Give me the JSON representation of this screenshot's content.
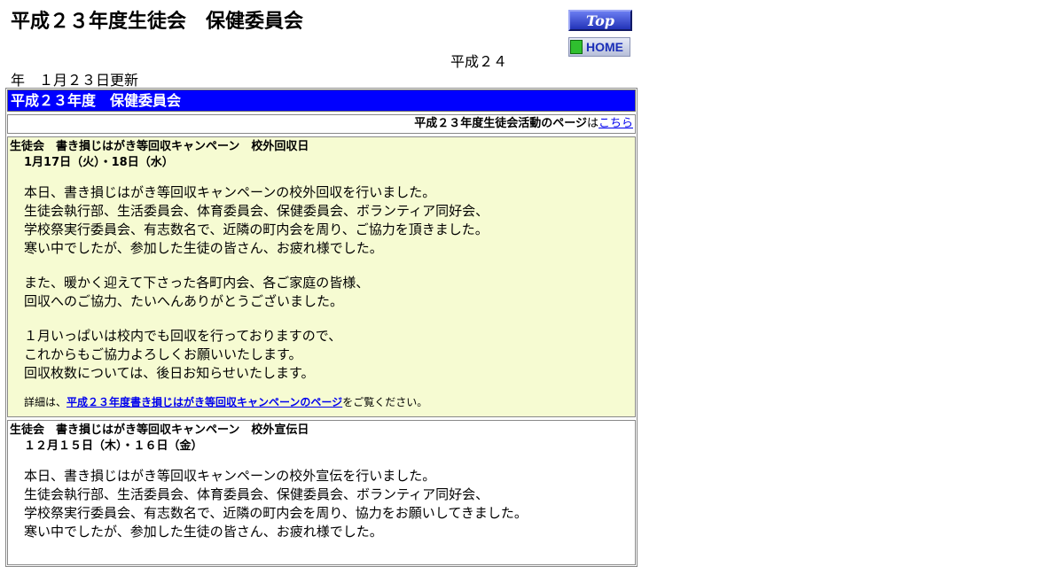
{
  "header": {
    "title": "平成２３年度生徒会　保健委員会",
    "update_part1": "平成２４",
    "update_part2": "年　１月２３日更新",
    "top_button_label": "Top",
    "home_button_label": "HOME"
  },
  "section": {
    "heading": "平成２３年度　保健委員会",
    "link_prefix": "平成２３年度生徒会活動のページ",
    "link_middle": "は",
    "link_text": "こちら"
  },
  "articles": [
    {
      "title": "生徒会　書き損じはがき等回収キャンペーン　校外回収日",
      "date": "1月17日（火）・18日（水）",
      "paragraphs": [
        [
          "本日、書き損じはがき等回収キャンペーンの校外回収を行いました。",
          "生徒会執行部、生活委員会、体育委員会、保健委員会、ボランティア同好会、",
          "学校祭実行委員会、有志数名で、近隣の町内会を周り、ご協力を頂きました。",
          "寒い中でしたが、参加した生徒の皆さん、お疲れ様でした。"
        ],
        [
          "また、暖かく迎えて下さった各町内会、各ご家庭の皆様、",
          "回収へのご協力、たいへんありがとうございました。"
        ],
        [
          "１月いっぱいは校内でも回収を行っておりますので、",
          "これからもご協力よろしくお願いいたします。",
          "回収枚数については、後日お知らせいたします。"
        ]
      ],
      "detail_prefix": "詳細は、",
      "detail_link": "平成２３年度書き損じはがき等回収キャンペーンのページ",
      "detail_suffix": "をご覧ください。"
    },
    {
      "title": "生徒会　書き損じはがき等回収キャンペーン　校外宣伝日",
      "date": "１２月１５日（木）・１６日（金）",
      "paragraphs": [
        [
          "本日、書き損じはがき等回収キャンペーンの校外宣伝を行いました。",
          "生徒会執行部、生活委員会、体育委員会、保健委員会、ボランティア同好会、",
          "学校祭実行委員会、有志数名で、近隣の町内会を周り、協力をお願いしてきました。",
          "寒い中でしたが、参加した生徒の皆さん、お疲れ様でした。"
        ]
      ]
    }
  ],
  "colors": {
    "header_bg": "#0000ff",
    "article_bg": "#f6fbd2",
    "link": "#0000ee"
  }
}
